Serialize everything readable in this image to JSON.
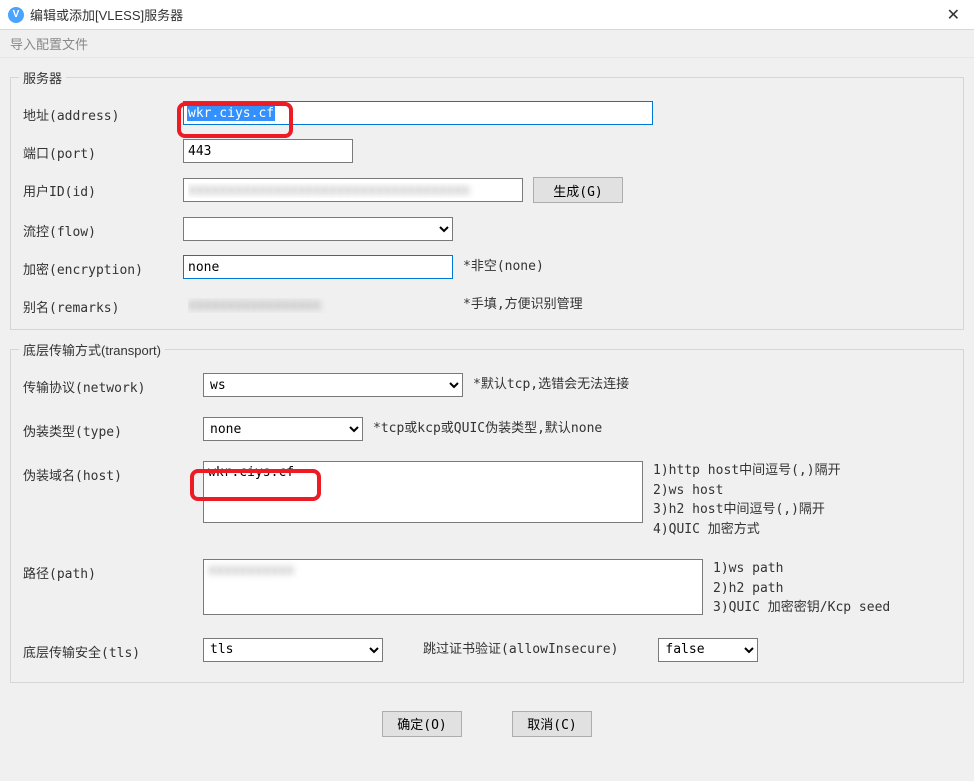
{
  "window": {
    "title": "编辑或添加[VLESS]服务器",
    "close": "✕",
    "import_menu": "导入配置文件"
  },
  "server": {
    "legend": "服务器",
    "address_label": "地址(address)",
    "address_value": "wkr.ciys.cf",
    "port_label": "端口(port)",
    "port_value": "443",
    "id_label": "用户ID(id)",
    "id_value": "xxxxxxxxxxxxxxxxxxxxxxxxxxxxxxxxxxxx",
    "generate_btn": "生成(G)",
    "flow_label": "流控(flow)",
    "flow_value": "",
    "encryption_label": "加密(encryption)",
    "encryption_value": "none",
    "encryption_hint": "*非空(none)",
    "remarks_label": "别名(remarks)",
    "remarks_value": "xxxxxxxxxxxxxxxxx",
    "remarks_hint": "*手填,方便识别管理"
  },
  "transport": {
    "legend": "底层传输方式(transport)",
    "network_label": "传输协议(network)",
    "network_value": "ws",
    "network_hint": "*默认tcp,选错会无法连接",
    "type_label": "伪装类型(type)",
    "type_value": "none",
    "type_hint": "*tcp或kcp或QUIC伪装类型,默认none",
    "host_label": "伪装域名(host)",
    "host_value": "wkr.ciys.cf",
    "host_hint1": "1)http host中间逗号(,)隔开",
    "host_hint2": "2)ws host",
    "host_hint3": "3)h2 host中间逗号(,)隔开",
    "host_hint4": "4)QUIC 加密方式",
    "path_label": "路径(path)",
    "path_value": "xxxxxxxxxxx",
    "path_hint1": "1)ws path",
    "path_hint2": "2)h2 path",
    "path_hint3": "3)QUIC 加密密钥/Kcp seed",
    "tls_label": "底层传输安全(tls)",
    "tls_value": "tls",
    "allowinsecure_label": "跳过证书验证(allowInsecure)",
    "allowinsecure_value": "false"
  },
  "footer": {
    "ok": "确定(O)",
    "cancel": "取消(C)"
  }
}
